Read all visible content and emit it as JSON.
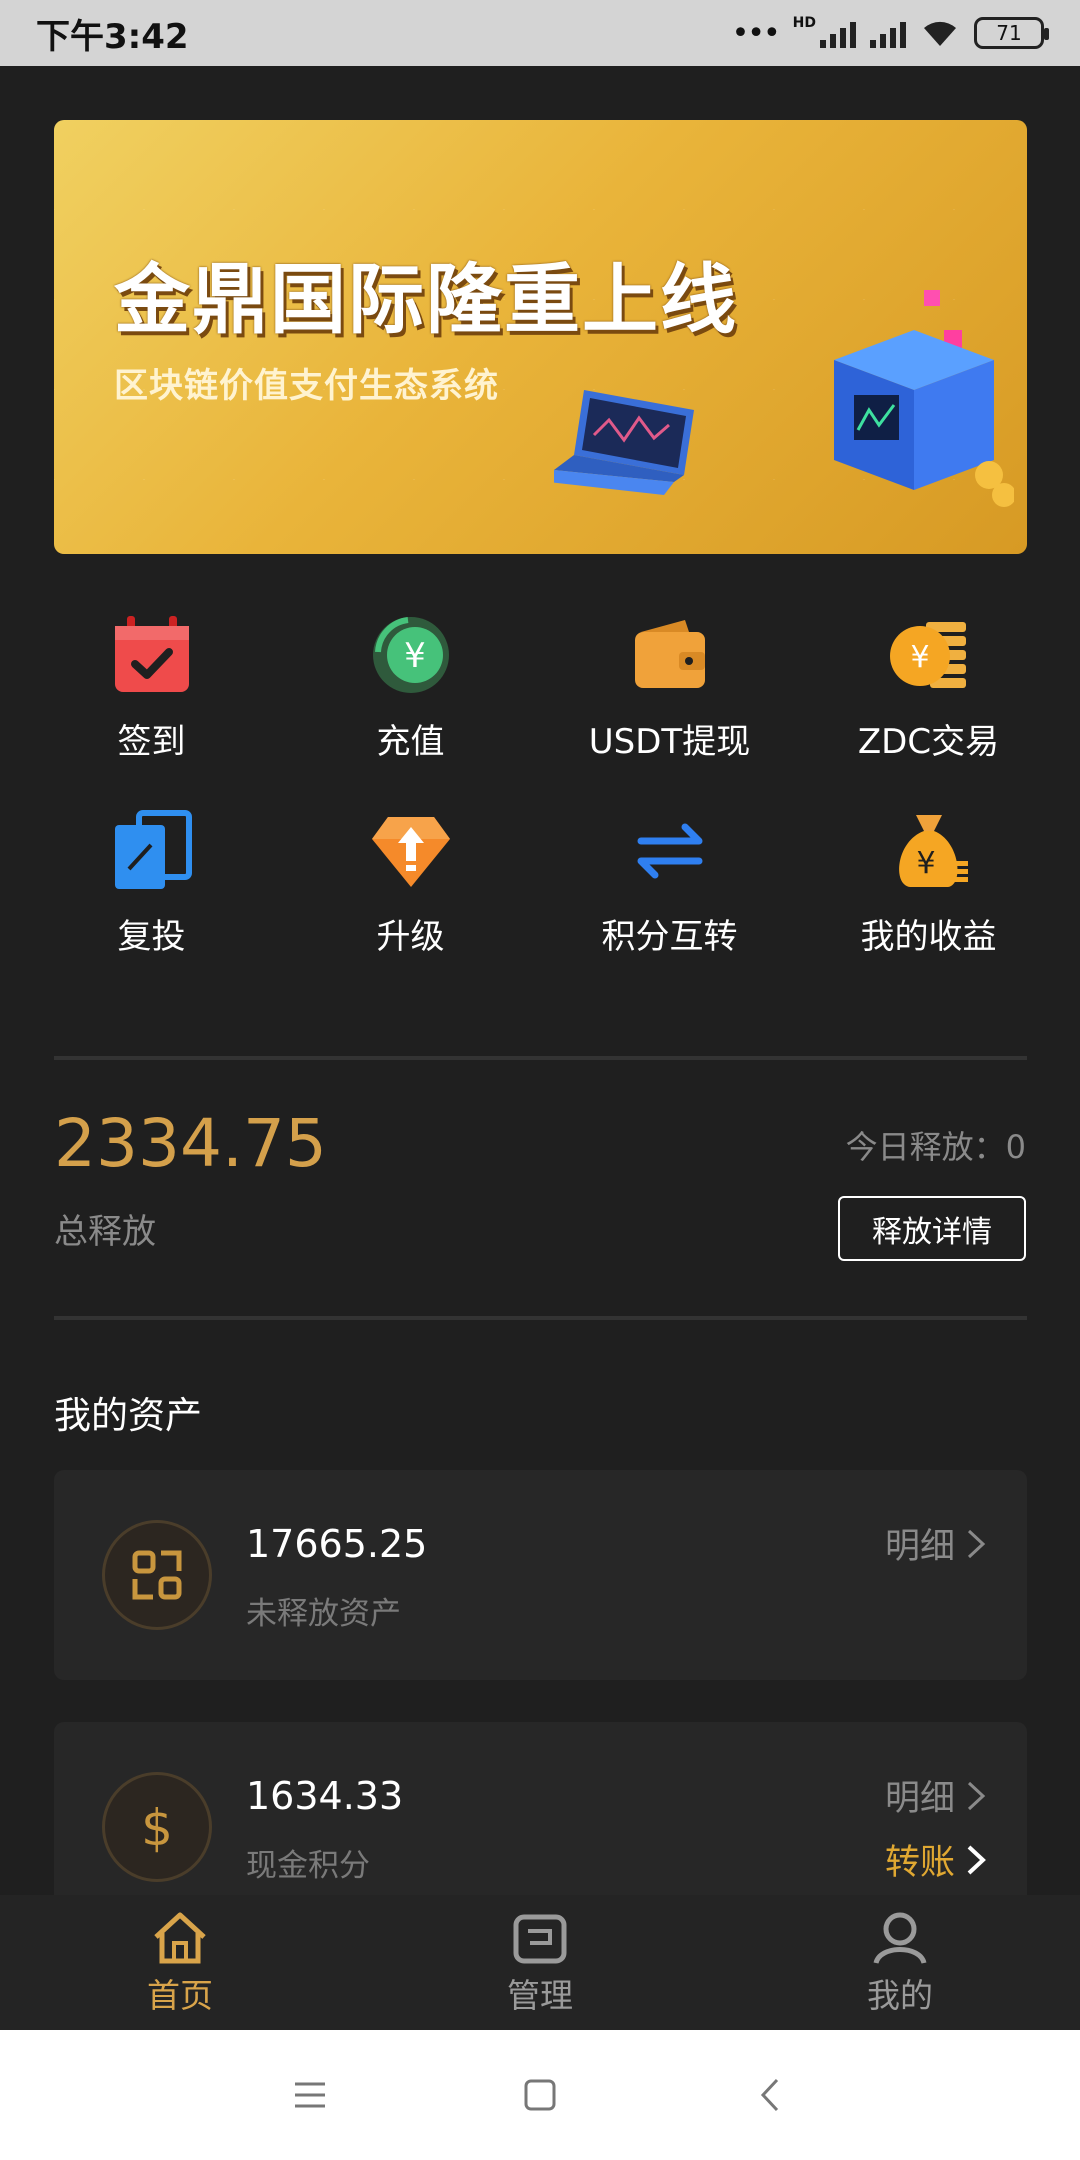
{
  "status_bar": {
    "time": "下午3:42",
    "network": "HD",
    "battery": "71"
  },
  "banner": {
    "title": "金鼎国际隆重上线",
    "subtitle": "区块链价值支付生态系统"
  },
  "menu": [
    {
      "label": "签到",
      "icon": "calendar-check-icon"
    },
    {
      "label": "充值",
      "icon": "yuan-refresh-icon"
    },
    {
      "label": "USDT提现",
      "icon": "wallet-icon"
    },
    {
      "label": "ZDC交易",
      "icon": "coin-stack-icon"
    },
    {
      "label": "复投",
      "icon": "reinvest-icon"
    },
    {
      "label": "升级",
      "icon": "upgrade-diamond-icon"
    },
    {
      "label": "积分互转",
      "icon": "transfer-arrows-icon"
    },
    {
      "label": "我的收益",
      "icon": "money-bag-icon"
    }
  ],
  "release": {
    "total_value": "2334.75",
    "total_label": "总释放",
    "today": "今日释放：0",
    "detail_button": "释放详情"
  },
  "assets": {
    "title": "我的资产",
    "items": [
      {
        "value": "17665.25",
        "label": "未释放资产",
        "detail_link": "明细"
      },
      {
        "value": "1634.33",
        "label": "现金积分",
        "detail_link": "明细",
        "transfer_link": "转账"
      }
    ]
  },
  "tabbar": [
    {
      "label": "首页",
      "icon": "home-icon",
      "active": true
    },
    {
      "label": "管理",
      "icon": "wallet-card-icon",
      "active": false
    },
    {
      "label": "我的",
      "icon": "user-icon",
      "active": false
    }
  ],
  "colors": {
    "accent": "#d9a44a",
    "background": "#1f1f1f",
    "card": "#272727"
  }
}
